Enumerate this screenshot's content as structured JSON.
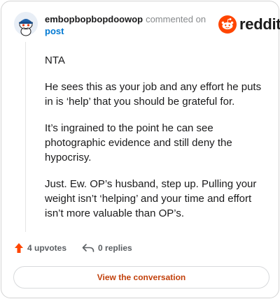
{
  "header": {
    "username": "embopbopbopdoowop",
    "action_text": "commented on",
    "link_text": "post"
  },
  "brand": {
    "name": "reddit",
    "color": "#ff4500"
  },
  "comment": {
    "paragraphs": [
      "NTA",
      "He sees this as your job and any effort he puts in is ‘help’ that you should be grateful for.",
      "It’s ingrained to the point he can see photographic evidence and still deny the hypocrisy.",
      "Just. Ew. OP’s husband, step up. Pulling your weight isn’t ‘helping’ and your time and effort isn’t more valuable than OP’s."
    ]
  },
  "actions": {
    "upvotes": "4 upvotes",
    "replies": "0 replies"
  },
  "cta": {
    "label": "View the conversation"
  },
  "icons": [
    "snoo-avatar-icon",
    "reddit-logo-icon",
    "upvote-arrow-icon",
    "reply-arrow-icon"
  ]
}
